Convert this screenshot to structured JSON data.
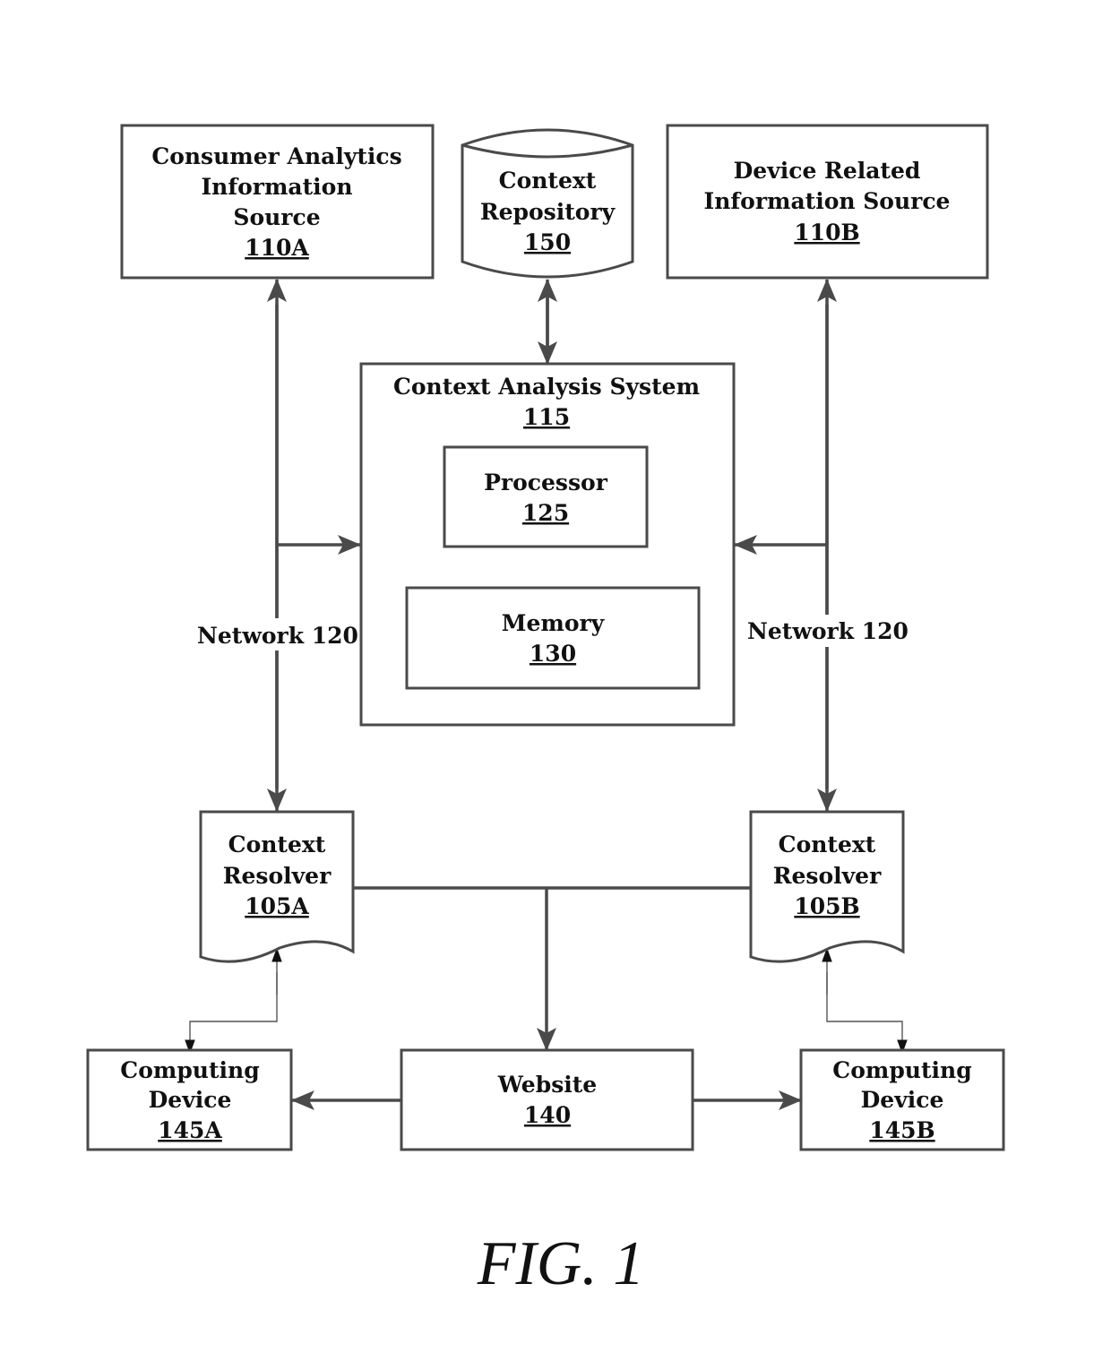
{
  "figure": {
    "caption": "FIG. 1",
    "line_color": "#4a4a4a",
    "text_color": "#111111"
  },
  "nodes": {
    "consumer_analytics": {
      "lines": [
        "Consumer Analytics",
        "Information",
        "Source"
      ],
      "ref": "110A"
    },
    "context_repository": {
      "lines": [
        "Context",
        "Repository"
      ],
      "ref": "150"
    },
    "device_related": {
      "lines": [
        "Device Related",
        "Information Source"
      ],
      "ref": "110B"
    },
    "context_analysis": {
      "lines": [
        "Context Analysis System"
      ],
      "ref": "115"
    },
    "processor": {
      "lines": [
        "Processor"
      ],
      "ref": "125"
    },
    "memory": {
      "lines": [
        "Memory"
      ],
      "ref": "130"
    },
    "resolver_a": {
      "lines": [
        "Context",
        "Resolver"
      ],
      "ref": "105A"
    },
    "resolver_b": {
      "lines": [
        "Context",
        "Resolver"
      ],
      "ref": "105B"
    },
    "computing_a": {
      "lines": [
        "Computing",
        "Device"
      ],
      "ref": "145A"
    },
    "website": {
      "lines": [
        "Website"
      ],
      "ref": "140"
    },
    "computing_b": {
      "lines": [
        "Computing",
        "Device"
      ],
      "ref": "145B"
    }
  },
  "network_labels": {
    "left": "Network 120",
    "right": "Network 120"
  }
}
